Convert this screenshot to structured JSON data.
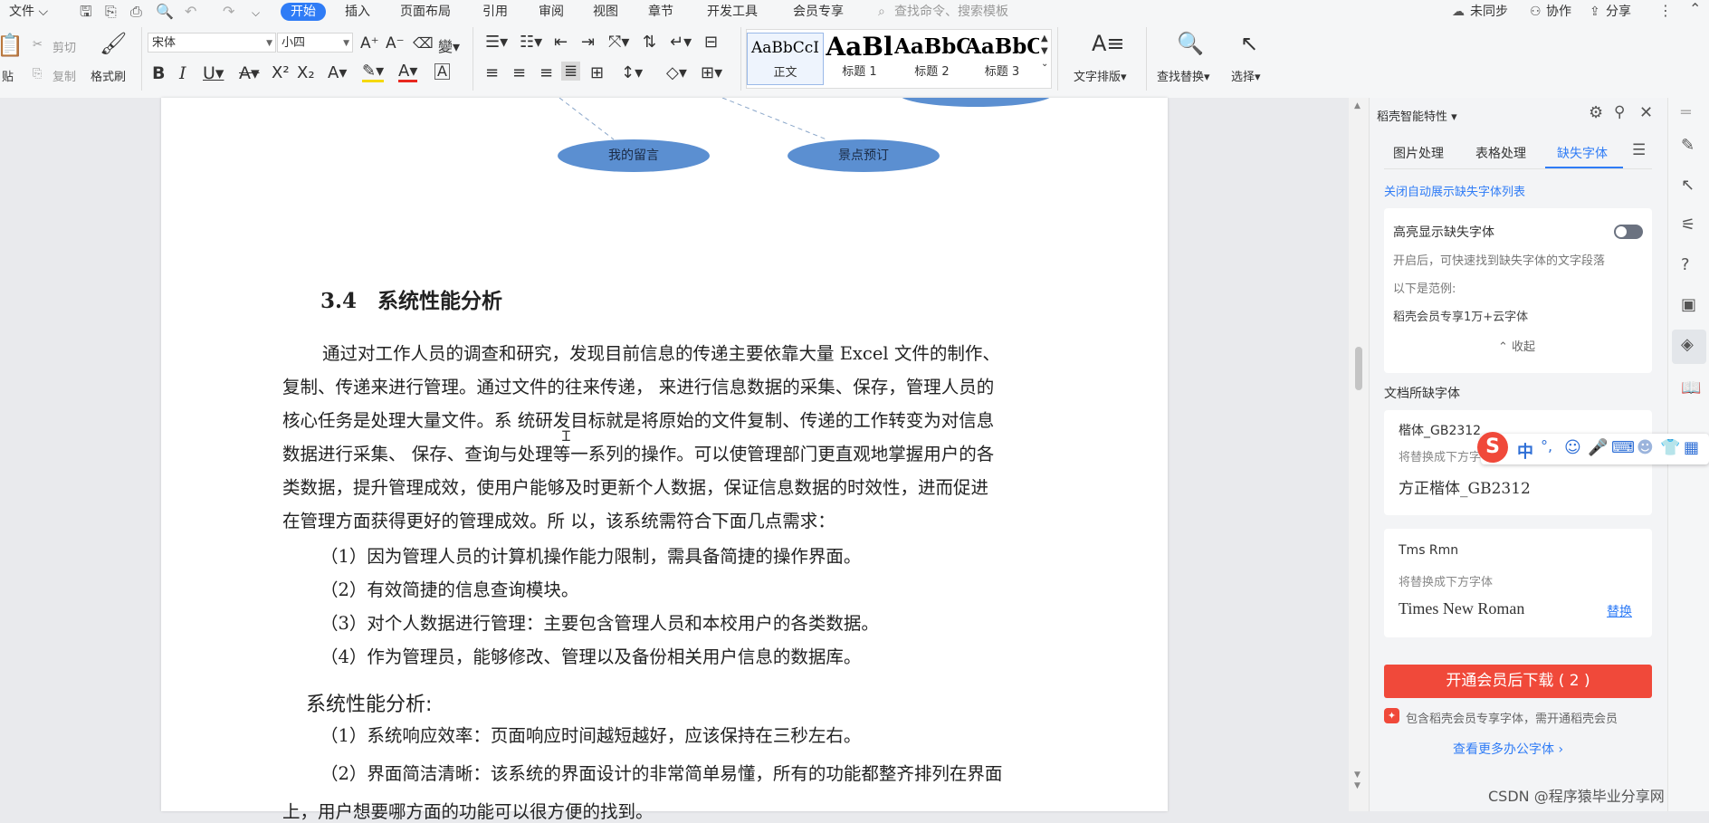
{
  "titlebar": {
    "file_menu": "文件",
    "tabs": [
      "开始",
      "插入",
      "页面布局",
      "引用",
      "审阅",
      "视图",
      "章节",
      "开发工具",
      "会员专享"
    ],
    "search_placeholder": "查找命令、搜索模板",
    "sync": "未同步",
    "collab": "协作",
    "share": "分享"
  },
  "ribbon": {
    "paste": "贴",
    "cut": "剪切",
    "copy": "复制",
    "format_painter": "格式刷",
    "font_name": "宋体",
    "font_size": "小四",
    "styles": [
      {
        "preview": "AaBbCcI",
        "label": "正文"
      },
      {
        "preview": "AaBl",
        "label": "标题 1"
      },
      {
        "preview": "AaBbC",
        "label": "标题 2"
      },
      {
        "preview": "AaBbC",
        "label": "标题 3"
      }
    ],
    "text_layout": "文字排版",
    "find_replace": "查找替换",
    "select": "选择"
  },
  "document": {
    "ellipse1": "我的留言",
    "ellipse2": "景点预订",
    "heading": "3.4　系统性能分析",
    "para_lines": [
      "通过对工作人员的调查和研究，发现目前信息的传递主要依靠大量 Excel 文件的制作、",
      "复制、传递来进行管理。通过文件的往来传递，  来进行信息数据的采集、保存，管理人员的",
      "核心任务是处理大量文件。系  统研发目标就是将原始的文件复制、传递的工作转变为对信息",
      "数据进行采集、  保存、查询与处理等一系列的操作。可以使管理部门更直观地掌握用户的各",
      "类数据，提升管理成效，使用户能够及时更新个人数据，保证信息数据的时效性，进而促进",
      "在管理方面获得更好的管理成效。所  以，该系统需符合下面几点需求："
    ],
    "items": [
      "（1）因为管理人员的计算机操作能力限制，需具备简捷的操作界面。",
      "（2）有效简捷的信息查询模块。",
      "（3）对个人数据进行管理：主要包含管理人员和本校用户的各类数据。",
      "（4）作为管理员，能够修改、管理以及备份相关用户信息的数据库。"
    ],
    "subheading": "系统性能分析:",
    "perf_items": [
      "（1）系统响应效率：页面响应时间越短越好，应该保持在三秒左右。",
      "（2）界面简洁清晰：该系统的界面设计的非常简单易懂，所有的功能都整齐排列在界面",
      "上，用户想要哪方面的功能可以很方便的找到。"
    ]
  },
  "panel": {
    "title": "稻壳智能特性",
    "tabs": [
      "图片处理",
      "表格处理",
      "缺失字体"
    ],
    "close_auto": "关闭自动展示缺失字体列表",
    "highlight_title": "高亮显示缺失字体",
    "highlight_desc": "开启后，可快速找到缺失字体的文字段落",
    "example_label": "以下是范例:",
    "example_value": "稻壳会员专享1万+云字体",
    "collapse": "收起",
    "missing_title": "文档所缺字体",
    "fonts": [
      {
        "name": "楷体_GB2312",
        "hint": "将替换成下方字体",
        "replace": "方正楷体_GB2312",
        "action": ""
      },
      {
        "name": "Tms Rmn",
        "hint": "将替换成下方字体",
        "replace": "Times New Roman",
        "action": "替换"
      }
    ],
    "download_button": "开通会员后下载 ( 2 )",
    "member_note": "包含稻壳会员专享字体，需开通稻壳会员",
    "more_fonts": "查看更多办公字体 ›"
  },
  "ime": {
    "lang": "中",
    "punct": "°,"
  },
  "watermark": "CSDN @程序猿毕业分享网",
  "colors": {
    "accent": "#2f7cf6",
    "download": "#f0493a",
    "ellipse": "#5b8fd1"
  }
}
